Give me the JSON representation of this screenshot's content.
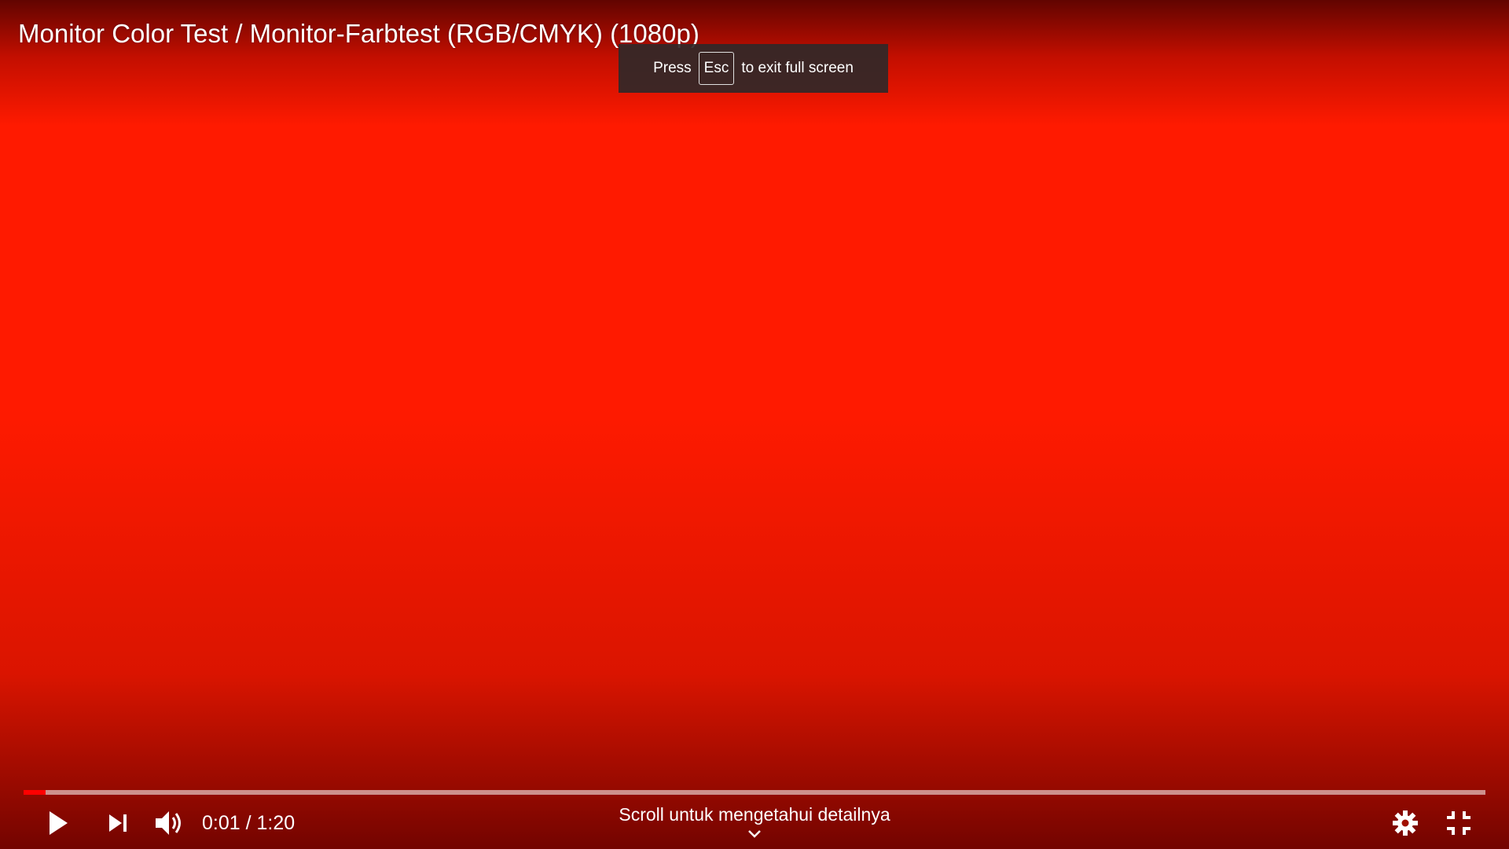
{
  "player": {
    "title": "Monitor Color Test / Monitor-Farbtest (RGB/CMYK) (1080p)",
    "background_color": "#ff1a00",
    "progress_fraction": 0.015,
    "played_color": "#ff0000"
  },
  "fullscreen_toast": {
    "prefix": "Press",
    "key": "Esc",
    "suffix": "to exit full screen"
  },
  "controls": {
    "time_current": "0:01",
    "time_separator": "/",
    "time_total": "1:20",
    "scroll_hint": "Scroll untuk mengetahui detailnya",
    "icons": [
      "play-icon",
      "next-icon",
      "volume-icon",
      "settings-icon",
      "exit-fullscreen-icon",
      "chevron-down-icon"
    ]
  }
}
